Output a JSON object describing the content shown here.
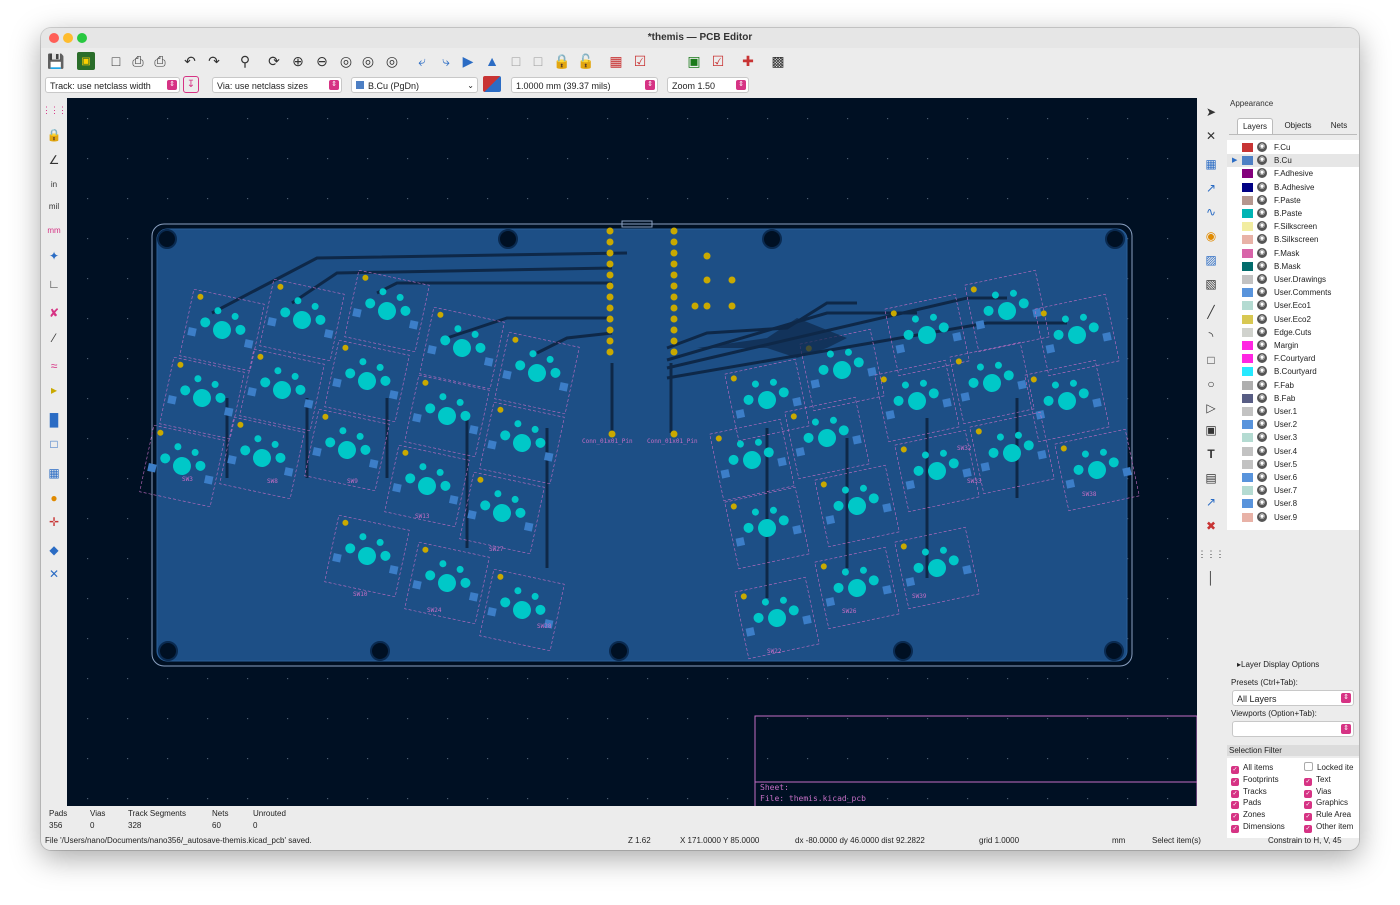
{
  "window": {
    "title": "*themis — PCB Editor"
  },
  "toolbar": {
    "track_width": "Track: use netclass width",
    "via_size": "Via: use netclass sizes",
    "layer": "B.Cu (PgDn)",
    "grid": "1.0000 mm (39.37 mils)",
    "zoom": "Zoom 1.50"
  },
  "left_tools": [
    "grid-dots-icon",
    "lock-icon",
    "polar-icon",
    "inch-units-icon",
    "mil-units-icon",
    "mm-units-icon",
    "cursor-icon",
    "ratsnest-icon",
    "curved-ratsnest-icon",
    "track-outline-icon",
    "via-outline-icon",
    "zone-fill-icon",
    "highlight-net-icon",
    "layer-stack-icon",
    "teardrop-icon",
    "tune-icon",
    "board-setup-icon",
    "wrench-icon"
  ],
  "left_tool_labels": {
    "inch": "in",
    "mil": "mil",
    "mm": "mm"
  },
  "right_tools": [
    "select-arrow-icon",
    "local-ratsnest-icon",
    "footprint-icon",
    "route-track-icon",
    "route-diffpair-icon",
    "tune-length-icon",
    "via-icon",
    "zone-icon",
    "rule-area-icon",
    "line-icon",
    "arc-icon",
    "rectangle-icon",
    "circle-icon",
    "polygon-icon",
    "image-icon",
    "text-icon",
    "textbox-icon",
    "dimension-icon",
    "delete-icon",
    "grid-origin-icon",
    "measure-icon"
  ],
  "canvas": {
    "board_labels": [
      "Conn_01x01_Pin",
      "Conn_01x01_Pin"
    ],
    "switch_labels": [
      "SW3",
      "SW8",
      "SW9",
      "SW13",
      "SW10",
      "SW24",
      "SW27",
      "SW28",
      "SW33",
      "SW38",
      "SW32",
      "SW39",
      "SW22",
      "SW26"
    ],
    "sheet_label": "Sheet:",
    "file_label": "File: themis.kicad_pcb",
    "colors": {
      "background": "#001023",
      "board": "#1d4f86",
      "pad": "#00c8c8",
      "pin": "#c9a900",
      "outline": "#c46ec4",
      "track": "#0e2848"
    }
  },
  "appearance": {
    "title": "Appearance",
    "tabs": [
      "Layers",
      "Objects",
      "Nets"
    ],
    "active_tab": "Layers",
    "layers": [
      {
        "name": "F.Cu",
        "color": "#c83434"
      },
      {
        "name": "B.Cu",
        "color": "#4d7fc4",
        "selected": true
      },
      {
        "name": "F.Adhesive",
        "color": "#84007c"
      },
      {
        "name": "B.Adhesive",
        "color": "#000084"
      },
      {
        "name": "F.Paste",
        "color": "#b4978f"
      },
      {
        "name": "B.Paste",
        "color": "#00b4b4"
      },
      {
        "name": "F.Silkscreen",
        "color": "#f2eda1"
      },
      {
        "name": "B.Silkscreen",
        "color": "#e8b2a7"
      },
      {
        "name": "F.Mask",
        "color": "#d864a9"
      },
      {
        "name": "B.Mask",
        "color": "#026c6c"
      },
      {
        "name": "User.Drawings",
        "color": "#c2c2c2"
      },
      {
        "name": "User.Comments",
        "color": "#5994dc"
      },
      {
        "name": "User.Eco1",
        "color": "#b4dbd2"
      },
      {
        "name": "User.Eco2",
        "color": "#d8c852"
      },
      {
        "name": "Edge.Cuts",
        "color": "#d0d2cd"
      },
      {
        "name": "Margin",
        "color": "#ff26e2"
      },
      {
        "name": "F.Courtyard",
        "color": "#ff26e2"
      },
      {
        "name": "B.Courtyard",
        "color": "#26e9ff"
      },
      {
        "name": "F.Fab",
        "color": "#afafaf"
      },
      {
        "name": "B.Fab",
        "color": "#585d84"
      },
      {
        "name": "User.1",
        "color": "#c2c2c2"
      },
      {
        "name": "User.2",
        "color": "#5994dc"
      },
      {
        "name": "User.3",
        "color": "#b4dbd2"
      },
      {
        "name": "User.4",
        "color": "#c2c2c2"
      },
      {
        "name": "User.5",
        "color": "#c2c2c2"
      },
      {
        "name": "User.6",
        "color": "#5994dc"
      },
      {
        "name": "User.7",
        "color": "#b4dbd2"
      },
      {
        "name": "User.8",
        "color": "#5994dc"
      },
      {
        "name": "User.9",
        "color": "#e8b2a7"
      }
    ],
    "layer_display_options": "Layer Display Options",
    "presets_label": "Presets (Ctrl+Tab):",
    "presets_value": "All Layers",
    "viewports_label": "Viewports (Option+Tab):",
    "viewports_value": ""
  },
  "selection_filter": {
    "title": "Selection Filter",
    "items": [
      {
        "label": "All items",
        "checked": true
      },
      {
        "label": "Locked ite",
        "checked": false
      },
      {
        "label": "Footprints",
        "checked": true
      },
      {
        "label": "Text",
        "checked": true
      },
      {
        "label": "Tracks",
        "checked": true
      },
      {
        "label": "Vias",
        "checked": true
      },
      {
        "label": "Pads",
        "checked": true
      },
      {
        "label": "Graphics",
        "checked": true
      },
      {
        "label": "Zones",
        "checked": true
      },
      {
        "label": "Rule Area",
        "checked": true
      },
      {
        "label": "Dimensions",
        "checked": true
      },
      {
        "label": "Other item",
        "checked": true
      }
    ]
  },
  "stats": {
    "pads_label": "Pads",
    "pads": "356",
    "vias_label": "Vias",
    "vias": "0",
    "tracks_label": "Track Segments",
    "tracks": "328",
    "nets_label": "Nets",
    "nets": "60",
    "unrouted_label": "Unrouted",
    "unrouted": "0"
  },
  "status": {
    "message": "File '/Users/nano/Documents/nano356/_autosave-themis.kicad_pcb' saved.",
    "z": "Z 1.62",
    "xy": "X 171.0000  Y 85.0000",
    "delta": "dx -80.0000  dy 46.0000  dist 92.2822",
    "grid": "grid 1.0000",
    "units": "mm",
    "mode": "Select item(s)",
    "constrain": "Constrain to H, V, 45"
  }
}
